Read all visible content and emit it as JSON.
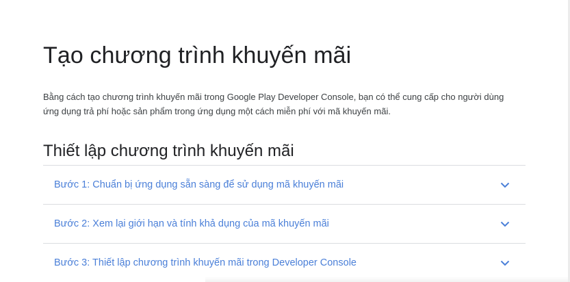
{
  "page": {
    "title": "Tạo chương trình khuyến mãi",
    "intro": "Bằng cách tạo chương trình khuyến mãi trong Google Play Developer Console, bạn có thể cung cấp cho người dùng ứng dụng trả phí hoặc sản phẩm trong ứng dụng một cách miễn phí với mã khuyến mãi.",
    "section_title": "Thiết lập chương trình khuyến mãi"
  },
  "accordion": {
    "items": [
      {
        "label": "Bước 1: Chuẩn bị ứng dụng sẵn sàng để sử dụng mã khuyến mãi",
        "icon": "chevron-down-icon"
      },
      {
        "label": "Bước 2: Xem lại giới hạn và tính khả dụng của mã khuyến mãi",
        "icon": "chevron-down-icon"
      },
      {
        "label": "Bước 3: Thiết lập chương trình khuyến mãi trong Developer Console",
        "icon": "chevron-down-icon"
      }
    ]
  },
  "colors": {
    "link": "#4a7fd8",
    "text": "#202124",
    "divider": "#dadce0"
  }
}
